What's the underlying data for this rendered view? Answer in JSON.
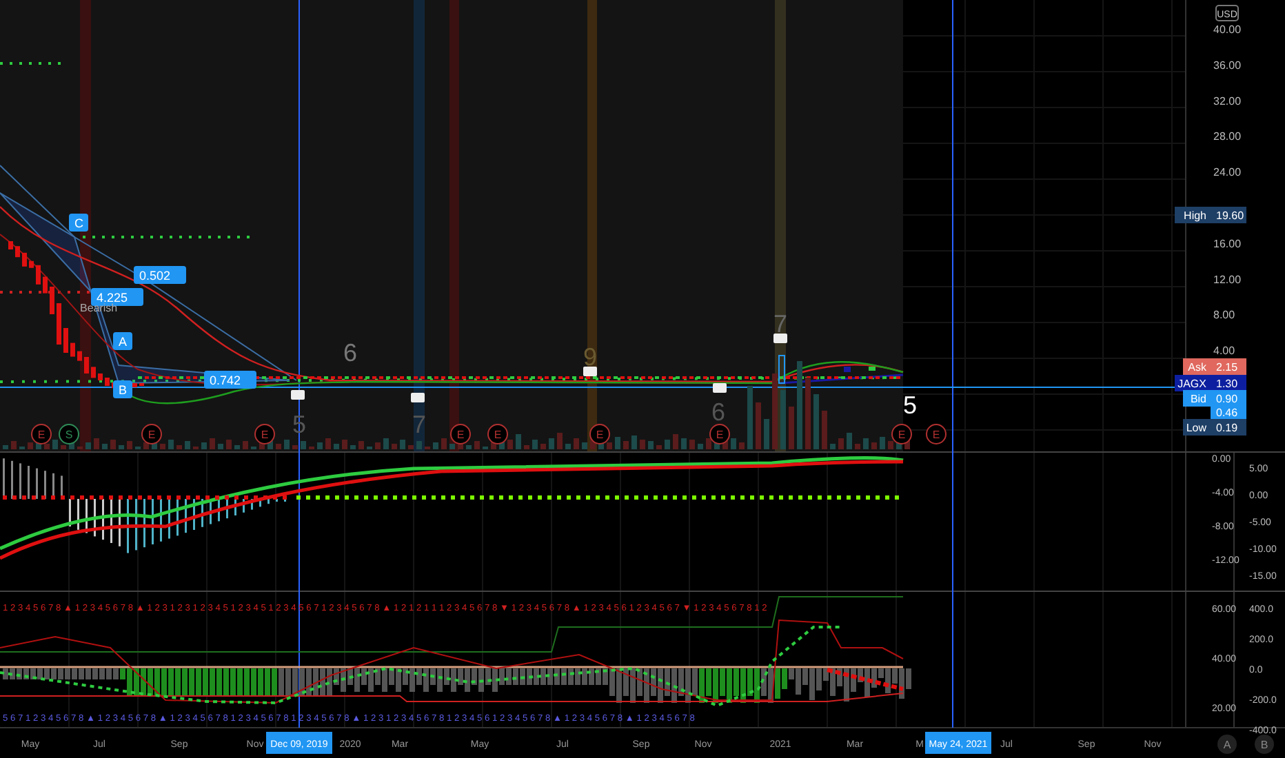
{
  "price_axis": {
    "unit": "USD",
    "ticks": [
      "40.00",
      "36.00",
      "32.00",
      "28.00",
      "24.00",
      "16.00",
      "12.00",
      "8.00",
      "4.00"
    ]
  },
  "price_labels": [
    {
      "label": "High",
      "value": "19.60",
      "color": "#1e3f66"
    },
    {
      "label": "Ask",
      "value": "2.15",
      "color": "#e0685e"
    },
    {
      "label": "JAGX",
      "value": "1.30",
      "color": "#0d1fa0"
    },
    {
      "label": "Bid",
      "value": "0.90",
      "color": "#2196f3"
    },
    {
      "value": "0.46",
      "color": "#2196f3"
    },
    {
      "label": "Low",
      "value": "0.19",
      "color": "#1e3f66"
    }
  ],
  "pattern_labels": [
    {
      "text": "C"
    },
    {
      "text": "0.502"
    },
    {
      "text": "4.225"
    },
    {
      "text": "A"
    },
    {
      "text": "B"
    },
    {
      "text": "0.742"
    }
  ],
  "pattern_note": "Bearish",
  "wave_counts": [
    {
      "text": "6"
    },
    {
      "text": "5"
    },
    {
      "text": "7"
    },
    {
      "text": "9"
    },
    {
      "text": "6"
    },
    {
      "text": "7"
    },
    {
      "text": "5"
    }
  ],
  "event_markers": [
    {
      "label": "E",
      "kind": "earnings"
    },
    {
      "label": "S",
      "kind": "split"
    },
    {
      "label": "E",
      "kind": "earnings"
    },
    {
      "label": "E",
      "kind": "earnings"
    },
    {
      "label": "E",
      "kind": "earnings"
    },
    {
      "label": "E",
      "kind": "earnings"
    },
    {
      "label": "E",
      "kind": "earnings"
    },
    {
      "label": "E",
      "kind": "earnings"
    },
    {
      "label": "E",
      "kind": "earnings"
    },
    {
      "label": "E",
      "kind": "earnings"
    }
  ],
  "oscillator_axis_a": [
    "0.00",
    "-4.00",
    "-8.00",
    "-12.00"
  ],
  "oscillator_axis_b": [
    "5.00",
    "0.00",
    "-5.00",
    "-10.00",
    "-15.00"
  ],
  "indicator_axis_a": [
    "60.00",
    "40.00",
    "20.00"
  ],
  "indicator_axis_b": [
    "400.0",
    "200.0",
    "0.0",
    "-200.0",
    "-400.0"
  ],
  "sequence_top": "1 2 3 4 5 6 7 8 ▲ 1 2 3 4 5 6 7 8 ▲ 1 2 3 1 2 3 1 2 3 4 5 1 2 3 4 5 1 2 3 4 5 6 7 1 2 3 4 5 6 7 8 ▲ 1 2 1 2 1 1 1 2 3 4 5 6 7 8 ▼ 1 2 3 4 5 6 7 8 ▲ 1 2 3 4 5 6 1 2 3 4 5 6 7 ▼ 1 2 3 4 5 6 7 8 1 2",
  "sequence_bottom": "5 6 7 1 2 3 4 5 6 7 8 ▲ 1 2 3 4 5 6 7 8 ▲ 1 2 3 4 5 6 7 8 1 2 3 4 5 6 7 8 1 2 3 4 5 6 7 8 ▲ 1 2 3 1 2 3 4 5 6 7 8 1 2 3 4 5 6 1 2 3 4 5 6 7 8 ▲ 1 2 3 4 5 6 7 8 ▲ 1 2 3 4 5 6 7 8",
  "time_axis": [
    {
      "text": "May",
      "selected": false
    },
    {
      "text": "Jul",
      "selected": false
    },
    {
      "text": "Sep",
      "selected": false
    },
    {
      "text": "Nov",
      "selected": false
    },
    {
      "text": "Dec 09, 2019",
      "selected": true
    },
    {
      "text": "2020",
      "selected": false
    },
    {
      "text": "Mar",
      "selected": false
    },
    {
      "text": "May",
      "selected": false
    },
    {
      "text": "Jul",
      "selected": false
    },
    {
      "text": "Sep",
      "selected": false
    },
    {
      "text": "Nov",
      "selected": false
    },
    {
      "text": "2021",
      "selected": false
    },
    {
      "text": "Mar",
      "selected": false
    },
    {
      "text": "M",
      "selected": false
    },
    {
      "text": "May 24, 2021",
      "selected": true
    },
    {
      "text": "Jul",
      "selected": false
    },
    {
      "text": "Sep",
      "selected": false
    },
    {
      "text": "Nov",
      "selected": false
    }
  ],
  "scale_buttons": [
    "A",
    "B"
  ]
}
